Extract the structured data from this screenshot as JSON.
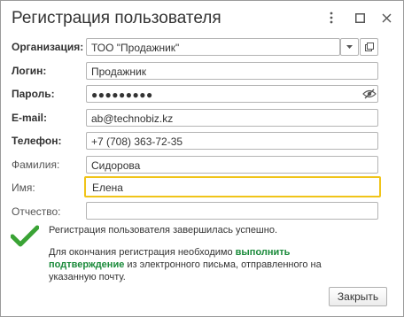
{
  "window": {
    "title": "Регистрация пользователя"
  },
  "icons": {
    "more": "vertical-ellipsis-icon",
    "maximize": "maximize-icon",
    "close": "close-icon",
    "dropdown": "chevron-down-icon",
    "open": "open-in-new-icon",
    "show_password": "eye-off-icon",
    "success": "checkmark-icon"
  },
  "form": {
    "organization": {
      "label": "Организация:",
      "value": "ТОО \"Продажник\""
    },
    "login": {
      "label": "Логин:",
      "value": "Продажник"
    },
    "password": {
      "label": "Пароль:",
      "value": "●●●●●●●●●"
    },
    "email": {
      "label": "E-mail:",
      "value": "ab@technobiz.kz"
    },
    "phone": {
      "label": "Телефон:",
      "value": "+7 (708) 363-72-35"
    },
    "last_name": {
      "label": "Фамилия:",
      "value": "Сидорова"
    },
    "first_name": {
      "label": "Имя:",
      "value": "Елена"
    },
    "middle_name": {
      "label": "Отчество:",
      "value": ""
    }
  },
  "message": {
    "success": "Регистрация пользователя завершилась успешно.",
    "confirm_prefix": "Для окончания регистрация необходимо ",
    "confirm_link": "выполнить подтверждение",
    "confirm_suffix": " из электронного письма, отправленного на указанную почту."
  },
  "buttons": {
    "close_label": "Закрыть"
  },
  "colors": {
    "focus_border": "#f0c419",
    "link": "#1a8a3a",
    "check": "#3aa335"
  }
}
